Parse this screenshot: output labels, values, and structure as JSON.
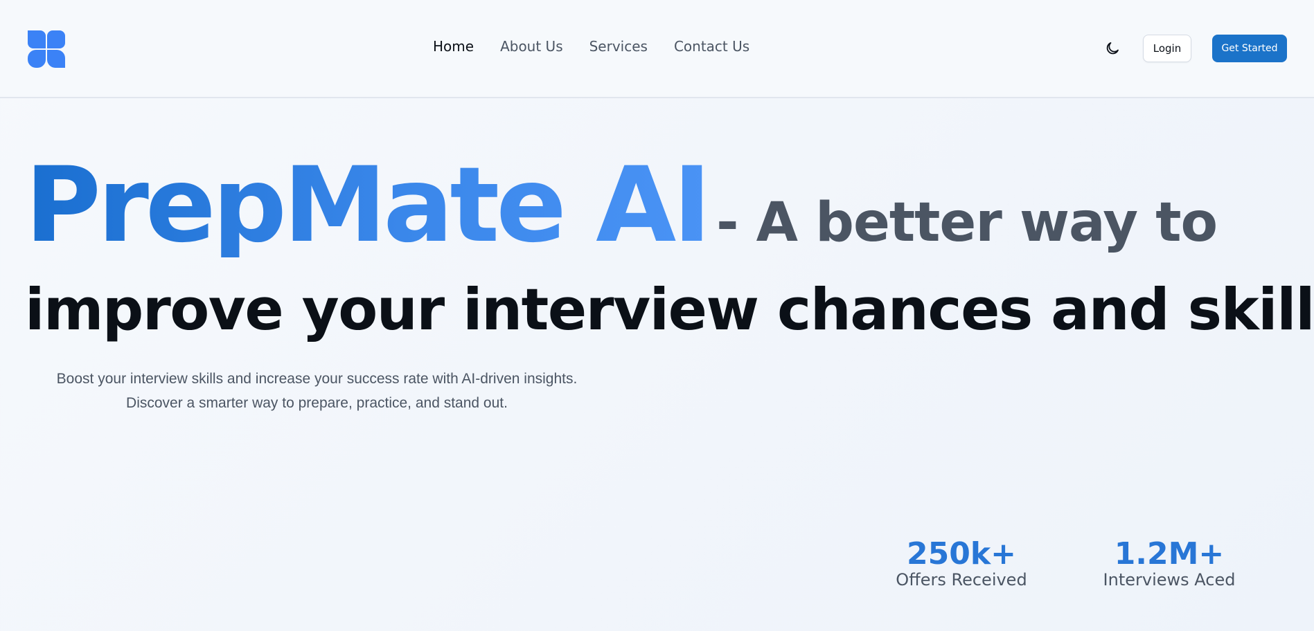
{
  "brand": {
    "logo_icon": "clover-logo-icon",
    "logo_color": "#3b82f6"
  },
  "nav": {
    "items": [
      {
        "label": "Home",
        "active": true
      },
      {
        "label": "About Us",
        "active": false
      },
      {
        "label": "Services",
        "active": false
      },
      {
        "label": "Contact Us",
        "active": false
      }
    ]
  },
  "header": {
    "theme_toggle_icon": "moon-icon",
    "login_label": "Login",
    "cta_label": "Get Started",
    "cta_color": "#1b73c9"
  },
  "hero": {
    "brand_name": "PrepMate AI",
    "tagline_part1": "- A better way to",
    "tagline_part2": "improve your interview chances and skills",
    "sub_line1": "Boost your interview skills and increase your success rate with AI-driven insights.",
    "sub_line2": "Discover a smarter way to prepare, practice, and stand out."
  },
  "stats": [
    {
      "value": "250k+",
      "label": "Offers Received"
    },
    {
      "value": "1.2M+",
      "label": "Interviews Aced"
    }
  ]
}
